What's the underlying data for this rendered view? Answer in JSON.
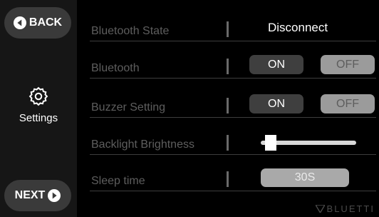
{
  "sidebar": {
    "back_label": "BACK",
    "next_label": "NEXT",
    "section_label": "Settings"
  },
  "settings": {
    "bluetooth_state": {
      "label": "Bluetooth State",
      "value": "Disconnect"
    },
    "bluetooth": {
      "label": "Bluetooth",
      "on_label": "ON",
      "off_label": "OFF",
      "selected": "OFF"
    },
    "buzzer": {
      "label": "Buzzer Setting",
      "on_label": "ON",
      "off_label": "OFF",
      "selected": "OFF"
    },
    "backlight": {
      "label": "Backlight Brightness",
      "level": 0.05
    },
    "sleep_time": {
      "label": "Sleep time",
      "value": "30S"
    }
  },
  "brand": {
    "logo_text": "BLUETTI"
  },
  "colors": {
    "background": "#000000",
    "sidebar": "#161616",
    "button": "#3a3a3a",
    "off_active": "#9b9b9b"
  },
  "icons": {
    "back": "arrow-left-circle-icon",
    "next": "arrow-right-circle-icon",
    "settings": "gear-icon"
  }
}
